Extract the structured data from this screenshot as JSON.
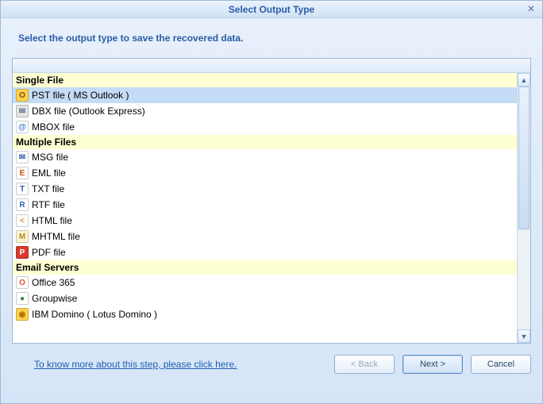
{
  "window": {
    "title": "Select Output Type",
    "close_glyph": "✕"
  },
  "instruction": "Select the output type to save the recovered data.",
  "groups": [
    {
      "header": "Single File",
      "items": [
        {
          "label": "PST file ( MS Outlook )",
          "icon": "pst-icon",
          "selected": true
        },
        {
          "label": "DBX file (Outlook Express)",
          "icon": "dbx-icon"
        },
        {
          "label": "MBOX file",
          "icon": "mbox-icon"
        }
      ]
    },
    {
      "header": "Multiple Files",
      "items": [
        {
          "label": "MSG file",
          "icon": "msg-icon"
        },
        {
          "label": "EML file",
          "icon": "eml-icon"
        },
        {
          "label": "TXT file",
          "icon": "txt-icon"
        },
        {
          "label": "RTF file",
          "icon": "rtf-icon"
        },
        {
          "label": "HTML file",
          "icon": "html-icon"
        },
        {
          "label": "MHTML file",
          "icon": "mhtml-icon"
        },
        {
          "label": "PDF file",
          "icon": "pdf-icon"
        }
      ]
    },
    {
      "header": "Email Servers",
      "items": [
        {
          "label": "Office 365",
          "icon": "office365-icon"
        },
        {
          "label": "Groupwise",
          "icon": "groupwise-icon"
        },
        {
          "label": "IBM Domino ( Lotus Domino )",
          "icon": "domino-icon"
        }
      ]
    }
  ],
  "icons": {
    "pst-icon": {
      "bg": "#ffd24d",
      "fg": "#7a4a00",
      "glyph": "O"
    },
    "dbx-icon": {
      "bg": "#e5e5e5",
      "fg": "#5b6b8c",
      "glyph": "✉"
    },
    "mbox-icon": {
      "bg": "#ffffff",
      "fg": "#3a78c8",
      "glyph": "@"
    },
    "msg-icon": {
      "bg": "#ffffff",
      "fg": "#2d5fb0",
      "glyph": "✉"
    },
    "eml-icon": {
      "bg": "#ffffff",
      "fg": "#cc4e00",
      "glyph": "E"
    },
    "txt-icon": {
      "bg": "#ffffff",
      "fg": "#2d5fb0",
      "glyph": "T"
    },
    "rtf-icon": {
      "bg": "#ffffff",
      "fg": "#2d5fb0",
      "glyph": "R"
    },
    "html-icon": {
      "bg": "#ffffff",
      "fg": "#e08a2e",
      "glyph": "<"
    },
    "mhtml-icon": {
      "bg": "#fff6d6",
      "fg": "#b58a1f",
      "glyph": "M"
    },
    "pdf-icon": {
      "bg": "#d93a2b",
      "fg": "#ffffff",
      "glyph": "P"
    },
    "office365-icon": {
      "bg": "#ffffff",
      "fg": "#e4552d",
      "glyph": "O"
    },
    "groupwise-icon": {
      "bg": "#ffffff",
      "fg": "#2d8a3d",
      "glyph": "●"
    },
    "domino-icon": {
      "bg": "#ffd24d",
      "fg": "#b06a00",
      "glyph": "◉"
    }
  },
  "footer": {
    "link": "To know more about this step, please click here.",
    "back": "< Back",
    "next": "Next >",
    "cancel": "Cancel"
  },
  "scroll": {
    "up_glyph": "▲",
    "down_glyph": "▼"
  }
}
